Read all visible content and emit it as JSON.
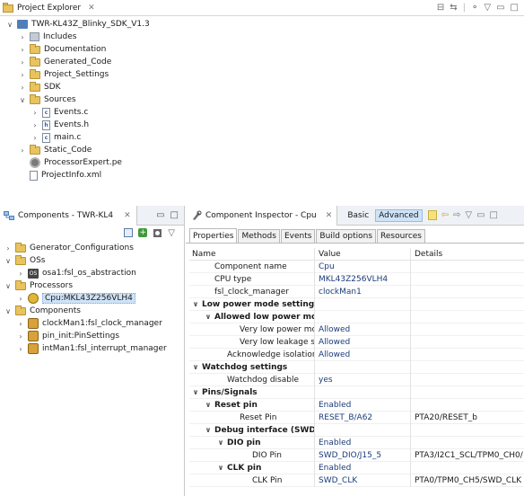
{
  "project_explorer": {
    "tab_title": "Project Explorer",
    "tree": [
      {
        "label": "TWR-KL43Z_Blinky_SDK_V1.3",
        "type": "project",
        "depth": 0,
        "expanded": true
      },
      {
        "label": "Includes",
        "type": "library",
        "depth": 1,
        "expanded": false
      },
      {
        "label": "Documentation",
        "type": "folder",
        "depth": 1,
        "expanded": false
      },
      {
        "label": "Generated_Code",
        "type": "folder",
        "depth": 1,
        "expanded": false
      },
      {
        "label": "Project_Settings",
        "type": "folder",
        "depth": 1,
        "expanded": false
      },
      {
        "label": "SDK",
        "type": "folder",
        "depth": 1,
        "expanded": false
      },
      {
        "label": "Sources",
        "type": "folder",
        "depth": 1,
        "expanded": true
      },
      {
        "label": "Events.c",
        "type": "c-file",
        "depth": 2,
        "expanded": false
      },
      {
        "label": "Events.h",
        "type": "h-file",
        "depth": 2,
        "expanded": false
      },
      {
        "label": "main.c",
        "type": "c-file",
        "depth": 2,
        "expanded": false
      },
      {
        "label": "Static_Code",
        "type": "folder",
        "depth": 1,
        "expanded": false
      },
      {
        "label": "ProcessorExpert.pe",
        "type": "pe-file",
        "depth": 1,
        "leaf": true
      },
      {
        "label": "ProjectInfo.xml",
        "type": "xml-file",
        "depth": 1,
        "leaf": true
      }
    ]
  },
  "components": {
    "tab_title": "Components - TWR-KL4",
    "tree": [
      {
        "label": "Generator_Configurations",
        "type": "folder",
        "depth": 0,
        "expanded": false
      },
      {
        "label": "OSs",
        "type": "folder",
        "depth": 0,
        "expanded": true
      },
      {
        "label": "osa1:fsl_os_abstraction",
        "type": "os-component",
        "depth": 1,
        "expanded": false
      },
      {
        "label": "Processors",
        "type": "folder",
        "depth": 0,
        "expanded": true
      },
      {
        "label": "Cpu:MKL43Z256VLH4",
        "type": "cpu-component",
        "depth": 1,
        "expanded": false,
        "selected": true
      },
      {
        "label": "Components",
        "type": "folder",
        "depth": 0,
        "expanded": true
      },
      {
        "label": "clockMan1:fsl_clock_manager",
        "type": "component",
        "depth": 1,
        "expanded": false
      },
      {
        "label": "pin_init:PinSettings",
        "type": "component",
        "depth": 1,
        "expanded": false
      },
      {
        "label": "intMan1:fsl_interrupt_manager",
        "type": "component",
        "depth": 1,
        "expanded": false
      }
    ]
  },
  "inspector": {
    "tab_title": "Component Inspector - Cpu",
    "mode_basic": "Basic",
    "mode_advanced": "Advanced",
    "subtabs": [
      "Properties",
      "Methods",
      "Events",
      "Build options",
      "Resources"
    ],
    "active_subtab": 0,
    "columns": {
      "name": "Name",
      "value": "Value",
      "details": "Details"
    },
    "rows": [
      {
        "name": "Component name",
        "value": "Cpu",
        "details": "",
        "depth": 1,
        "group": false
      },
      {
        "name": "CPU type",
        "value": "MKL43Z256VLH4",
        "details": "",
        "depth": 1,
        "group": false
      },
      {
        "name": "fsl_clock_manager",
        "value": "clockMan1",
        "details": "",
        "depth": 1,
        "group": false
      },
      {
        "name": "Low power mode settings",
        "value": "",
        "details": "",
        "depth": 0,
        "group": true
      },
      {
        "name": "Allowed low power modes",
        "value": "",
        "details": "",
        "depth": 1,
        "group": true
      },
      {
        "name": "Very low power modes",
        "value": "Allowed",
        "details": "",
        "depth": 3,
        "group": false
      },
      {
        "name": "Very low leakage stop",
        "value": "Allowed",
        "details": "",
        "depth": 3,
        "group": false
      },
      {
        "name": "Acknowledge isolation",
        "value": "Allowed",
        "details": "",
        "depth": 2,
        "group": false
      },
      {
        "name": "Watchdog settings",
        "value": "",
        "details": "",
        "depth": 0,
        "group": true
      },
      {
        "name": "Watchdog disable",
        "value": "yes",
        "details": "",
        "depth": 2,
        "group": false
      },
      {
        "name": "Pins/Signals",
        "value": "",
        "details": "",
        "depth": 0,
        "group": true
      },
      {
        "name": "Reset pin",
        "value": "Enabled",
        "details": "",
        "depth": 1,
        "group": true
      },
      {
        "name": "Reset Pin",
        "value": "RESET_B/A62",
        "details": "PTA20/RESET_b",
        "depth": 3,
        "group": false
      },
      {
        "name": "Debug interface (SWD)",
        "value": "",
        "details": "",
        "depth": 1,
        "group": true
      },
      {
        "name": "DIO pin",
        "value": "Enabled",
        "details": "",
        "depth": 2,
        "group": true
      },
      {
        "name": "DIO Pin",
        "value": "SWD_DIO/J15_5",
        "details": "PTA3/I2C1_SCL/TPM0_CH0/",
        "depth": 4,
        "group": false
      },
      {
        "name": "CLK pin",
        "value": "Enabled",
        "details": "",
        "depth": 2,
        "group": true
      },
      {
        "name": "CLK Pin",
        "value": "SWD_CLK",
        "details": "PTA0/TPM0_CH5/SWD_CLK",
        "depth": 4,
        "group": false
      }
    ]
  },
  "colors": {
    "selection": "#cfe3f7",
    "folder": "#e8c35e",
    "value_text": "#1a3c7a"
  }
}
